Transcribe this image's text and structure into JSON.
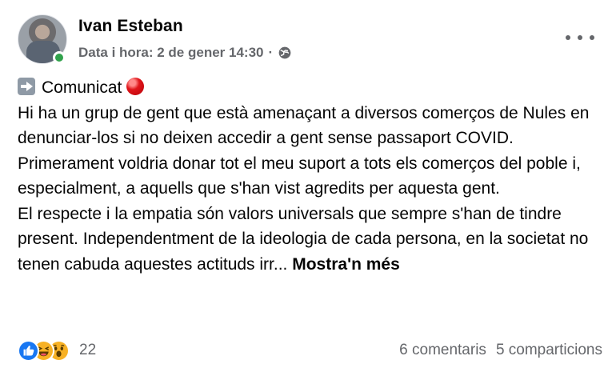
{
  "author": {
    "name": "Ivan Esteban",
    "timestamp": "Data i hora: 2 de gener 14:30",
    "separator": "·",
    "audience_icon": "globe-icon",
    "online": true
  },
  "menu": {
    "more_icon": "more-options-icon"
  },
  "post": {
    "title": "Comunicat",
    "title_icons": [
      "right-arrow-icon",
      "red-circle-icon"
    ],
    "paragraph_1": "Hi ha un grup de gent que està amenaçant a diversos comerços de Nules en denunciar-los si no deixen accedir a gent sense passaport COVID.",
    "paragraph_2": "Primerament voldria donar tot el meu suport a tots els comerços del poble i, especialment, a aquells que s'han vist agredits per aquesta gent.",
    "paragraph_3": "El respecte i la empatia són valors universals que sempre s'han de tindre present. Independentment de la ideologia de cada persona, en la societat no tenen cabuda aquestes actituds irr...",
    "see_more": "Mostra'n més"
  },
  "footer": {
    "reactions": [
      "like-icon",
      "haha-icon",
      "wow-icon"
    ],
    "reaction_count": "22",
    "comments": "6 comentaris",
    "shares": "5 comparticions"
  },
  "colors": {
    "text": "#050505",
    "secondary_text": "#65676b",
    "online": "#31a24c",
    "like_blue": "#1877f2",
    "emoji_yellow": "#f7b125",
    "red_circle": "#e0161b"
  }
}
